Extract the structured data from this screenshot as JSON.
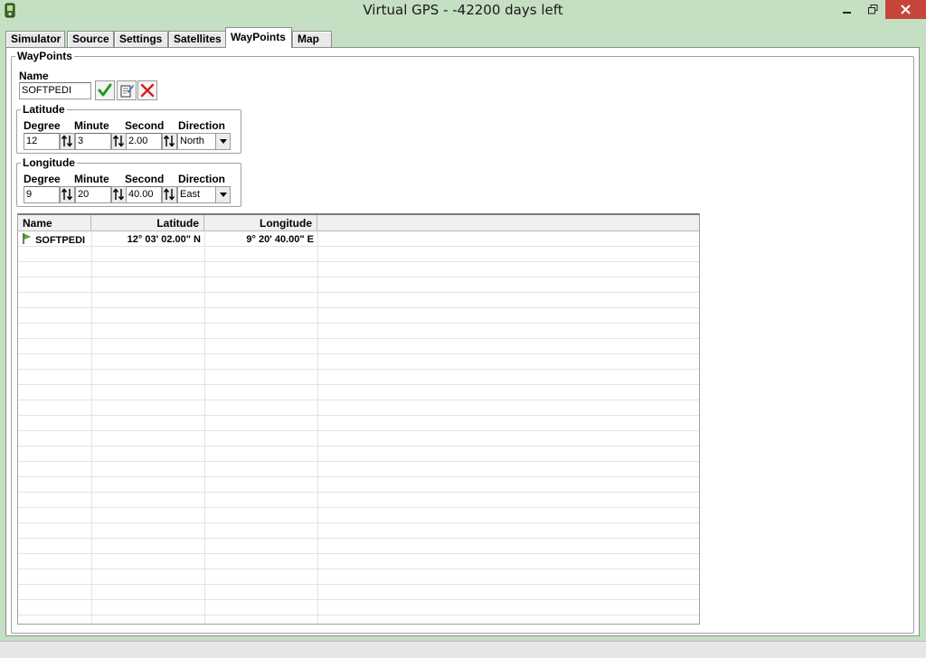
{
  "window": {
    "title": "Virtual GPS - -42200 days left",
    "icon": "gps-device-icon"
  },
  "tabs": [
    {
      "label": "Simulator",
      "active": false
    },
    {
      "label": "Source",
      "active": false
    },
    {
      "label": "Settings",
      "active": false
    },
    {
      "label": "Satellites",
      "active": false
    },
    {
      "label": "WayPoints",
      "active": true
    },
    {
      "label": "Map",
      "active": false
    }
  ],
  "waypoints": {
    "group_title": "WayPoints",
    "name_label": "Name",
    "name_value": "SOFTPEDI",
    "buttons": [
      {
        "icon": "check-icon",
        "color": "#1f9d1f"
      },
      {
        "icon": "edit-icon",
        "color": "#333333"
      },
      {
        "icon": "delete-x-icon",
        "color": "#d21f1f"
      }
    ],
    "latitude": {
      "title": "Latitude",
      "degree_label": "Degree",
      "minute_label": "Minute",
      "second_label": "Second",
      "direction_label": "Direction",
      "degree": "12",
      "minute": "3",
      "second": "2.00",
      "direction": "North"
    },
    "longitude": {
      "title": "Longitude",
      "degree_label": "Degree",
      "minute_label": "Minute",
      "second_label": "Second",
      "direction_label": "Direction",
      "degree": "9",
      "minute": "20",
      "second": "40.00",
      "direction": "East"
    }
  },
  "table": {
    "columns": [
      "Name",
      "Latitude",
      "Longitude"
    ],
    "rows": [
      {
        "name": "SOFTPEDI",
        "latitude": "12° 03' 02.00\" N",
        "longitude": "9° 20' 40.00\" E",
        "icon": "flag-icon"
      }
    ]
  },
  "colors": {
    "chrome": "#c5dfc2",
    "close_button": "#c7443a",
    "flag": "#5aa832"
  }
}
